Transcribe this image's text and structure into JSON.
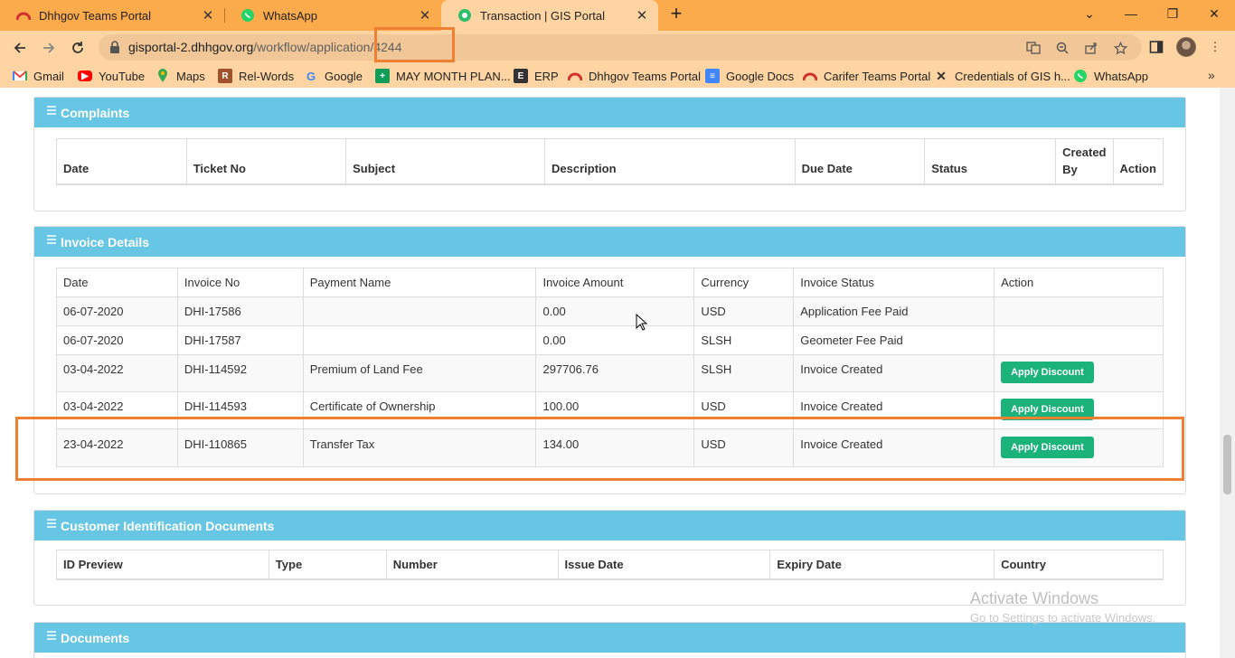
{
  "browser": {
    "tabs": [
      {
        "title": "Dhhgov Teams Portal",
        "icon": "teams-portal-icon"
      },
      {
        "title": "WhatsApp",
        "icon": "whatsapp-icon"
      },
      {
        "title": "Transaction | GIS Portal",
        "icon": "gis-portal-icon"
      }
    ],
    "url": {
      "host": "gisportal-2.dhhgov.org",
      "path": "/workflow/application/4244"
    },
    "bookmarks": [
      "Gmail",
      "YouTube",
      "Maps",
      "Rel-Words",
      "Google",
      "MAY MONTH PLAN...",
      "ERP",
      "Dhhgov Teams Portal",
      "Google Docs",
      "Carifer Teams Portal",
      "Credentials of GIS h...",
      "WhatsApp"
    ]
  },
  "complaints": {
    "title": "Complaints",
    "headers": [
      "Date",
      "Ticket No",
      "Subject",
      "Description",
      "Due Date",
      "Status",
      "Created By",
      "Action"
    ]
  },
  "invoices": {
    "title": "Invoice Details",
    "headers": [
      "Date",
      "Invoice No",
      "Payment Name",
      "Invoice Amount",
      "Currency",
      "Invoice Status",
      "Action"
    ],
    "button_label": "Apply Discount",
    "rows": [
      {
        "date": "06-07-2020",
        "no": "DHI-17586",
        "name": "",
        "amount": "0.00",
        "currency": "USD",
        "status": "Application Fee Paid",
        "action": ""
      },
      {
        "date": "06-07-2020",
        "no": "DHI-17587",
        "name": "",
        "amount": "0.00",
        "currency": "SLSH",
        "status": "Geometer Fee Paid",
        "action": ""
      },
      {
        "date": "03-04-2022",
        "no": "DHI-114592",
        "name": "Premium of Land Fee",
        "amount": "297706.76",
        "currency": "SLSH",
        "status": "Invoice Created",
        "action": "Apply Discount"
      },
      {
        "date": "03-04-2022",
        "no": "DHI-114593",
        "name": "Certificate of Ownership",
        "amount": "100.00",
        "currency": "USD",
        "status": "Invoice Created",
        "action": "Apply Discount"
      },
      {
        "date": "23-04-2022",
        "no": "DHI-110865",
        "name": "Transfer Tax",
        "amount": "134.00",
        "currency": "USD",
        "status": "Invoice Created",
        "action": "Apply Discount"
      }
    ]
  },
  "customer_docs": {
    "title": "Customer Identification Documents",
    "headers": [
      "ID Preview",
      "Type",
      "Number",
      "Issue Date",
      "Expiry Date",
      "Country"
    ]
  },
  "documents": {
    "title": "Documents"
  },
  "watermark": {
    "line1": "Activate Windows",
    "line2": "Go to Settings to activate Windows."
  },
  "colors": {
    "accent_header": "#67c6e3",
    "button_green": "#1bb37a",
    "annotation": "#ef7f33",
    "tabbar": "#fcab4c"
  }
}
